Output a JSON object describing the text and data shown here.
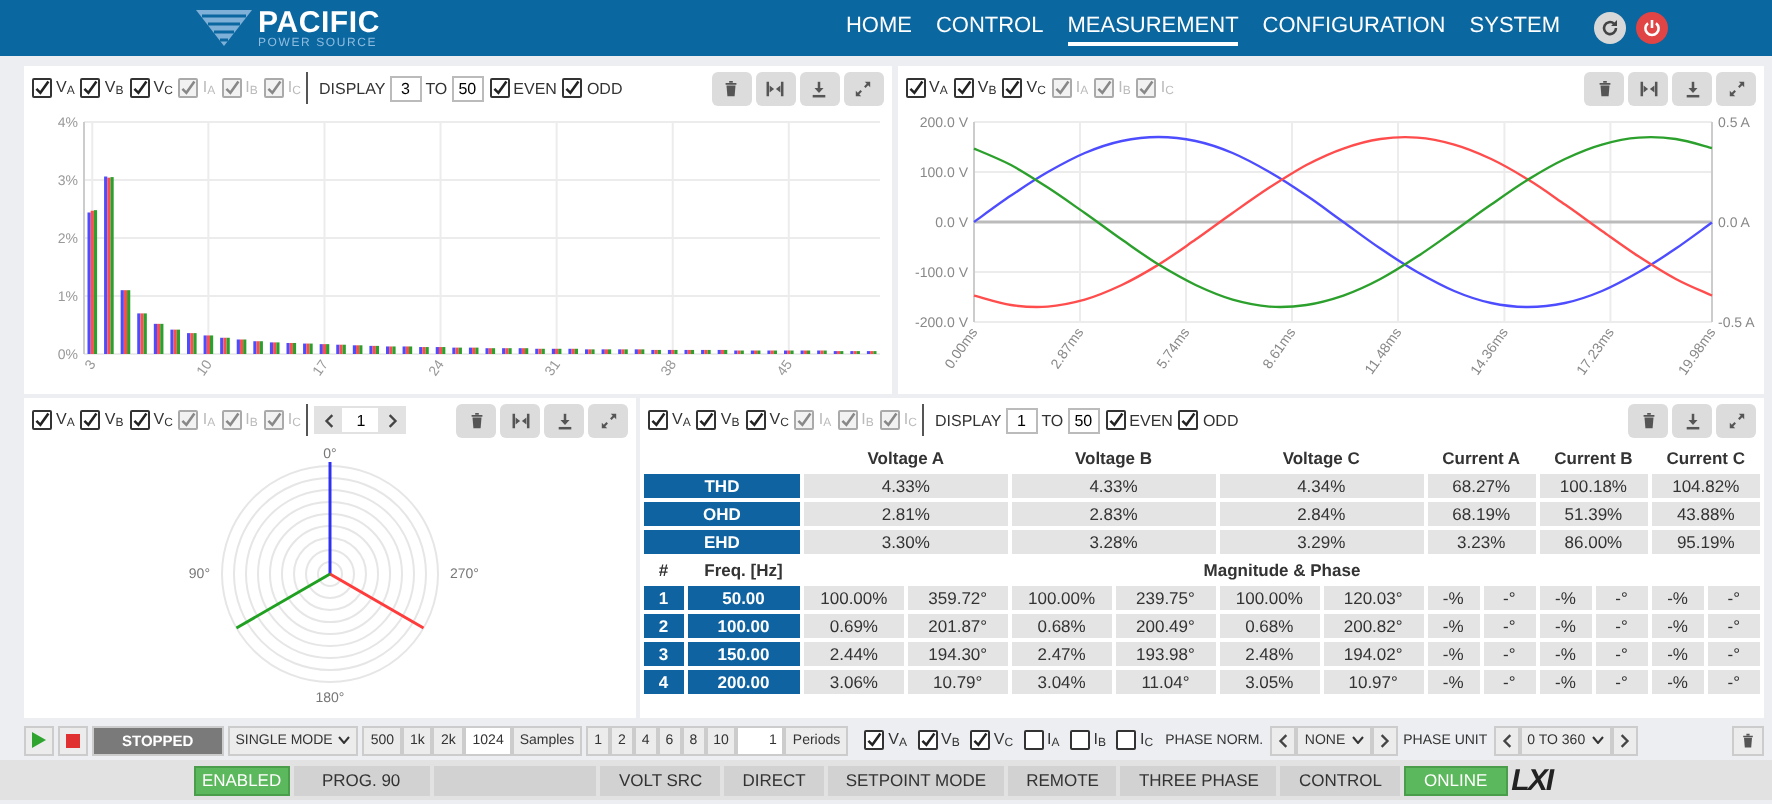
{
  "header": {
    "logo": {
      "name": "PACIFIC",
      "tagline": "POWER SOURCE"
    },
    "nav": [
      {
        "label": "HOME",
        "selected": false
      },
      {
        "label": "CONTROL",
        "selected": false
      },
      {
        "label": "MEASUREMENT",
        "selected": true
      },
      {
        "label": "CONFIGURATION",
        "selected": false
      },
      {
        "label": "SYSTEM",
        "selected": false
      }
    ]
  },
  "panels": [
    {
      "kind": "harmonics_chart",
      "channels": [
        {
          "label": "V$_{A}$",
          "checked": true,
          "disabled": false
        },
        {
          "label": "V$_{B}$",
          "checked": true,
          "disabled": false
        },
        {
          "label": "V$_{C}$",
          "checked": true,
          "disabled": false
        },
        {
          "label": "I$_{A}$",
          "checked": true,
          "disabled": true
        },
        {
          "label": "I$_{B}$",
          "checked": true,
          "disabled": true
        },
        {
          "label": "I$_{C}$",
          "checked": true,
          "disabled": true
        }
      ],
      "display": {
        "label": "DISPLAY",
        "from": "3",
        "to_label": "TO",
        "to": "50"
      },
      "filters": [
        {
          "label": "EVEN",
          "checked": true
        },
        {
          "label": "ODD",
          "checked": true
        }
      ],
      "tools": [
        {
          "kind": "delete"
        },
        {
          "kind": "fit"
        },
        {
          "kind": "download"
        },
        {
          "kind": "expand"
        }
      ],
      "chart_data": {
        "type": "bar",
        "grid": true,
        "xlim": [
          2.5,
          50.5
        ],
        "x": [
          3,
          4,
          5,
          6,
          7,
          8,
          9,
          10,
          11,
          12,
          13,
          14,
          15,
          16,
          17,
          18,
          19,
          20,
          21,
          22,
          23,
          24,
          25,
          26,
          27,
          28,
          29,
          30,
          31,
          32,
          33,
          34,
          35,
          36,
          37,
          38,
          39,
          40,
          41,
          42,
          43,
          44,
          45,
          46,
          47,
          48,
          49,
          50
        ],
        "series": [
          {
            "color": "#4d4dff",
            "values": [
              2.44,
              3.06,
              1.1,
              0.7,
              0.52,
              0.42,
              0.36,
              0.32,
              0.28,
              0.25,
              0.22,
              0.2,
              0.19,
              0.18,
              0.17,
              0.16,
              0.15,
              0.14,
              0.13,
              0.13,
              0.12,
              0.12,
              0.11,
              0.11,
              0.1,
              0.1,
              0.1,
              0.09,
              0.09,
              0.09,
              0.08,
              0.08,
              0.08,
              0.08,
              0.07,
              0.07,
              0.07,
              0.07,
              0.07,
              0.06,
              0.06,
              0.06,
              0.06,
              0.06,
              0.06,
              0.05,
              0.05,
              0.05
            ]
          },
          {
            "color": "#ff4d4d",
            "values": [
              2.47,
              3.04,
              1.1,
              0.7,
              0.52,
              0.42,
              0.36,
              0.32,
              0.28,
              0.25,
              0.22,
              0.2,
              0.19,
              0.18,
              0.17,
              0.16,
              0.15,
              0.14,
              0.13,
              0.13,
              0.12,
              0.12,
              0.11,
              0.11,
              0.1,
              0.1,
              0.1,
              0.09,
              0.09,
              0.09,
              0.08,
              0.08,
              0.08,
              0.08,
              0.07,
              0.07,
              0.07,
              0.07,
              0.07,
              0.06,
              0.06,
              0.06,
              0.06,
              0.06,
              0.06,
              0.05,
              0.05,
              0.05
            ]
          },
          {
            "color": "#2ca02c",
            "values": [
              2.48,
              3.05,
              1.1,
              0.7,
              0.52,
              0.42,
              0.36,
              0.32,
              0.28,
              0.25,
              0.22,
              0.2,
              0.19,
              0.18,
              0.17,
              0.16,
              0.15,
              0.14,
              0.13,
              0.13,
              0.12,
              0.12,
              0.11,
              0.11,
              0.1,
              0.1,
              0.1,
              0.09,
              0.09,
              0.09,
              0.08,
              0.08,
              0.08,
              0.08,
              0.07,
              0.07,
              0.07,
              0.07,
              0.07,
              0.06,
              0.06,
              0.06,
              0.06,
              0.06,
              0.06,
              0.05,
              0.05,
              0.05
            ]
          }
        ],
        "ylim": [
          0,
          4
        ],
        "yticks": [
          {
            "value": 0,
            "label": "0%"
          },
          {
            "value": 1,
            "label": "1%"
          },
          {
            "value": 2,
            "label": "2%"
          },
          {
            "value": 3,
            "label": "3%"
          },
          {
            "value": 4,
            "label": "4%"
          }
        ],
        "xticks": [
          3,
          10,
          17,
          24,
          31,
          38,
          45
        ]
      }
    },
    {
      "kind": "waveform_chart",
      "channels": [
        {
          "label": "V$_{A}$",
          "checked": true,
          "disabled": false
        },
        {
          "label": "V$_{B}$",
          "checked": true,
          "disabled": false
        },
        {
          "label": "V$_{C}$",
          "checked": true,
          "disabled": false
        },
        {
          "label": "I$_{A}$",
          "checked": true,
          "disabled": true
        },
        {
          "label": "I$_{B}$",
          "checked": true,
          "disabled": true
        },
        {
          "label": "I$_{C}$",
          "checked": true,
          "disabled": true
        }
      ],
      "tools": [
        {
          "kind": "delete"
        },
        {
          "kind": "fit"
        },
        {
          "kind": "download"
        },
        {
          "kind": "expand"
        }
      ],
      "right_axis_labels": [
        "0.5 A",
        "0.0 A",
        "-0.5 A"
      ],
      "chart_data": {
        "type": "line",
        "grid": true,
        "x": [
          0,
          1,
          2,
          3,
          4,
          5,
          6,
          7,
          8,
          9,
          10,
          11,
          12,
          13,
          14,
          15,
          16,
          17,
          18,
          19,
          19.98
        ],
        "series": [
          {
            "color": "#4d4dff",
            "values": [
              0,
              53,
              100,
              138,
              162,
              170,
              162,
              138,
              100,
              53,
              0,
              -53,
              -100,
              -138,
              -162,
              -170,
              -162,
              -138,
              -100,
              -53,
              -1
            ]
          },
          {
            "color": "#ff4d4d",
            "values": [
              -147,
              -166,
              -169,
              -155,
              -126,
              -85,
              -35,
              18,
              69,
              114,
              147,
              166,
              169,
              155,
              126,
              85,
              35,
              -18,
              -69,
              -114,
              -147
            ]
          },
          {
            "color": "#2ca02c",
            "values": [
              147,
              114,
              69,
              18,
              -35,
              -85,
              -126,
              -155,
              -169,
              -166,
              -147,
              -114,
              -69,
              -18,
              35,
              85,
              126,
              155,
              169,
              166,
              148
            ]
          }
        ],
        "xlim": [
          0,
          19.98
        ],
        "ylim": [
          -200,
          200
        ],
        "yticks": [
          {
            "value": 200,
            "label": "200.0 V"
          },
          {
            "value": 100,
            "label": "100.0 V"
          },
          {
            "value": 0,
            "label": "0.0 V"
          },
          {
            "value": -100,
            "label": "-100.0 V"
          },
          {
            "value": -200,
            "label": "-200.0 V"
          }
        ],
        "xticks": [
          {
            "value": 0,
            "label": "0.00ms"
          },
          {
            "value": 2.87,
            "label": "2.87ms"
          },
          {
            "value": 5.74,
            "label": "5.74ms"
          },
          {
            "value": 8.61,
            "label": "8.61ms"
          },
          {
            "value": 11.48,
            "label": "11.48ms"
          },
          {
            "value": 14.36,
            "label": "14.36ms"
          },
          {
            "value": 17.23,
            "label": "17.23ms"
          },
          {
            "value": 19.98,
            "label": "19.98ms"
          }
        ]
      }
    },
    {
      "kind": "phasor",
      "channels": [
        {
          "label": "V$_{A}$",
          "checked": true,
          "disabled": false
        },
        {
          "label": "V$_{B}$",
          "checked": true,
          "disabled": false
        },
        {
          "label": "V$_{C}$",
          "checked": true,
          "disabled": false
        },
        {
          "label": "I$_{A}$",
          "checked": true,
          "disabled": true
        },
        {
          "label": "I$_{B}$",
          "checked": true,
          "disabled": true
        },
        {
          "label": "I$_{C}$",
          "checked": true,
          "disabled": true
        }
      ],
      "pager": {
        "page": "1"
      },
      "tools": [
        {
          "kind": "delete"
        },
        {
          "kind": "fit"
        },
        {
          "kind": "download"
        },
        {
          "kind": "expand"
        }
      ],
      "angle_labels": [
        "0°",
        "90°",
        "180°",
        "270°"
      ]
    },
    {
      "kind": "harmonics_table",
      "channels": [
        {
          "label": "V$_{A}$",
          "checked": true,
          "disabled": false
        },
        {
          "label": "V$_{B}$",
          "checked": true,
          "disabled": false
        },
        {
          "label": "V$_{C}$",
          "checked": true,
          "disabled": false
        },
        {
          "label": "I$_{A}$",
          "checked": true,
          "disabled": true
        },
        {
          "label": "I$_{B}$",
          "checked": true,
          "disabled": true
        },
        {
          "label": "I$_{C}$",
          "checked": true,
          "disabled": true
        }
      ],
      "display": {
        "label": "DISPLAY",
        "from": "1",
        "to_label": "TO",
        "to": "50"
      },
      "filters": [
        {
          "label": "EVEN",
          "checked": true
        },
        {
          "label": "ODD",
          "checked": true
        }
      ],
      "tools": [
        {
          "kind": "delete"
        },
        {
          "kind": "download"
        },
        {
          "kind": "expand"
        }
      ],
      "table": {
        "columns": [
          "Voltage A",
          "Voltage B",
          "Voltage C",
          "Current A",
          "Current B",
          "Current C"
        ],
        "summary_rows": [
          {
            "label": "THD",
            "values": [
              "4.33%",
              "4.33%",
              "4.34%",
              "68.27%",
              "100.18%",
              "104.82%"
            ]
          },
          {
            "label": "OHD",
            "values": [
              "2.81%",
              "2.83%",
              "2.84%",
              "68.19%",
              "51.39%",
              "43.88%"
            ]
          },
          {
            "label": "EHD",
            "values": [
              "3.30%",
              "3.28%",
              "3.29%",
              "3.23%",
              "86.00%",
              "95.19%"
            ]
          }
        ],
        "detail_header": {
          "index": "#",
          "freq": "Freq. [Hz]",
          "span": "Magnitude & Phase"
        },
        "rows": [
          {
            "index": "1",
            "freq": "50.00",
            "cells": [
              [
                "100.00%",
                "359.72°"
              ],
              [
                "100.00%",
                "239.75°"
              ],
              [
                "100.00%",
                "120.03°"
              ],
              [
                "-%",
                "-°"
              ],
              [
                "-%",
                "-°"
              ],
              [
                "-%",
                "-°"
              ]
            ]
          },
          {
            "index": "2",
            "freq": "100.00",
            "cells": [
              [
                "0.69%",
                "201.87°"
              ],
              [
                "0.68%",
                "200.49°"
              ],
              [
                "0.68%",
                "200.82°"
              ],
              [
                "-%",
                "-°"
              ],
              [
                "-%",
                "-°"
              ],
              [
                "-%",
                "-°"
              ]
            ]
          },
          {
            "index": "3",
            "freq": "150.00",
            "cells": [
              [
                "2.44%",
                "194.30°"
              ],
              [
                "2.47%",
                "193.98°"
              ],
              [
                "2.48%",
                "194.02°"
              ],
              [
                "-%",
                "-°"
              ],
              [
                "-%",
                "-°"
              ],
              [
                "-%",
                "-°"
              ]
            ]
          },
          {
            "index": "4",
            "freq": "200.00",
            "cells": [
              [
                "3.06%",
                "10.79°"
              ],
              [
                "3.04%",
                "11.04°"
              ],
              [
                "3.05%",
                "10.97°"
              ],
              [
                "-%",
                "-°"
              ],
              [
                "-%",
                "-°"
              ],
              [
                "-%",
                "-°"
              ]
            ]
          }
        ]
      }
    }
  ],
  "controls": {
    "run_state": "STOPPED",
    "mode": "SINGLE MODE",
    "sample_presets": [
      "500",
      "1k",
      "2k"
    ],
    "samples": "1024",
    "samples_label": "Samples",
    "period_presets": [
      "1",
      "2",
      "4",
      "6",
      "8",
      "10"
    ],
    "periods": "1",
    "periods_label": "Periods",
    "channels": [
      {
        "label": "V$_{A}$",
        "checked": true
      },
      {
        "label": "V$_{B}$",
        "checked": true
      },
      {
        "label": "V$_{C}$",
        "checked": true
      },
      {
        "label": "I$_{A}$",
        "checked": false
      },
      {
        "label": "I$_{B}$",
        "checked": false
      },
      {
        "label": "I$_{C}$",
        "checked": false
      }
    ],
    "phase_norm": {
      "label": "PHASE NORM.",
      "value": "NONE"
    },
    "phase_unit": {
      "label": "PHASE UNIT",
      "value": "0 TO 360"
    }
  },
  "status_bar": {
    "items": [
      {
        "text": "ENABLED",
        "kind": "ok"
      },
      {
        "text": "PROG. 90",
        "kind": "plain"
      },
      {
        "kind": "blank"
      },
      {
        "text": "VOLT SRC",
        "kind": "plain"
      },
      {
        "text": "DIRECT",
        "kind": "plain"
      },
      {
        "text": "SETPOINT MODE",
        "kind": "plain"
      },
      {
        "text": "REMOTE",
        "kind": "plain"
      },
      {
        "text": "THREE PHASE",
        "kind": "plain"
      },
      {
        "text": "CONTROL",
        "kind": "plain"
      },
      {
        "text": "ONLINE",
        "kind": "ok"
      }
    ],
    "logo": "LXI"
  }
}
